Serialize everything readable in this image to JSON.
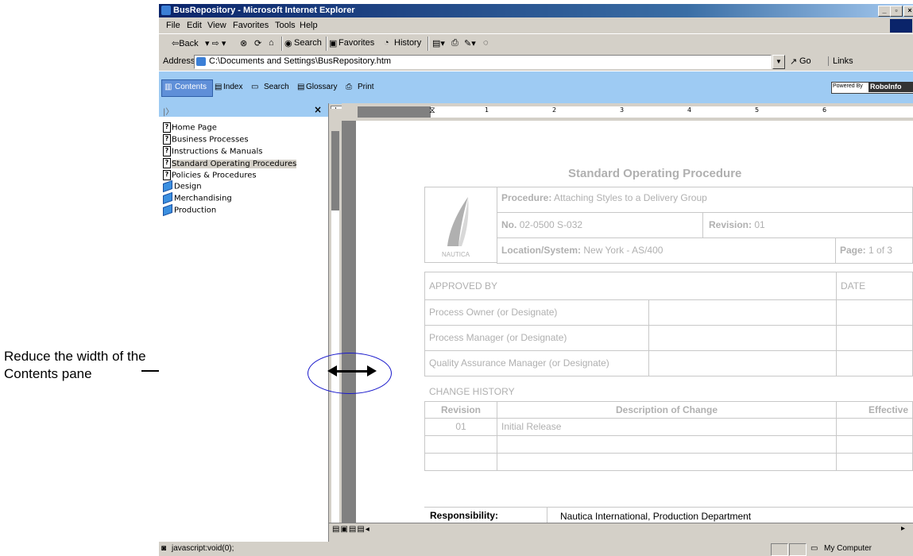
{
  "annotation": {
    "text": "Reduce the width of the Contents pane"
  },
  "window": {
    "title": "BusRepository - Microsoft Internet Explorer"
  },
  "menu": [
    "File",
    "Edit",
    "View",
    "Favorites",
    "Tools",
    "Help"
  ],
  "toolbar": {
    "back": "⇦Back",
    "search": "Search",
    "favorites": "Favorites",
    "history": "History"
  },
  "address": {
    "label": "Address",
    "value": "C:\\Documents and Settings\\BusRepository.htm",
    "go": "Go",
    "links": "Links"
  },
  "robohelp": {
    "tabs": [
      "Contents",
      "Index",
      "Search",
      "Glossary",
      "Print"
    ],
    "powered_by": "Powered By",
    "brand": "RoboInfo"
  },
  "tree": {
    "items": [
      {
        "label": "Home Page",
        "icon": "help-topic-icon"
      },
      {
        "label": "Business Processes",
        "icon": "help-topic-icon"
      },
      {
        "label": "Instructions & Manuals",
        "icon": "help-topic-icon"
      },
      {
        "label": "Standard Operating Procedures",
        "icon": "help-topic-icon",
        "selected": true
      },
      {
        "label": "Policies & Procedures",
        "icon": "help-topic-icon"
      },
      {
        "label": "Design",
        "icon": "book-icon"
      },
      {
        "label": "Merchandising",
        "icon": "book-icon"
      },
      {
        "label": "Production",
        "icon": "book-icon"
      }
    ]
  },
  "ruler": {
    "marks": [
      "1",
      "2",
      "3",
      "4",
      "5",
      "6"
    ]
  },
  "doc": {
    "title": "Standard Operating Procedure",
    "logo_text": "NAUTICA",
    "procedure_label": "Procedure:",
    "procedure_value": "Attaching Styles to a Delivery Group",
    "no_label": "No.",
    "no_value": "02-0500 S-032",
    "revision_label": "Revision:",
    "revision_value": "01",
    "location_label": "Location/System:",
    "location_value": "New York - AS/400",
    "page_label": "Page:",
    "page_value": "1 of 3",
    "approved_by": "APPROVED BY",
    "date": "DATE",
    "approvers": [
      "Process Owner (or Designate)",
      "Process Manager (or Designate)",
      "Quality Assurance Manager (or Designate)"
    ],
    "change_history": "CHANGE HISTORY",
    "col_revision": "Revision",
    "col_description": "Description of Change",
    "col_effective": "Effective",
    "history_rev": "01",
    "history_desc": "Initial Release",
    "responsibility_label": "Responsibility:",
    "responsibility_value": "Nautica International, Production Department"
  },
  "status": {
    "left": "javascript:void(0);",
    "zone": "My Computer"
  }
}
